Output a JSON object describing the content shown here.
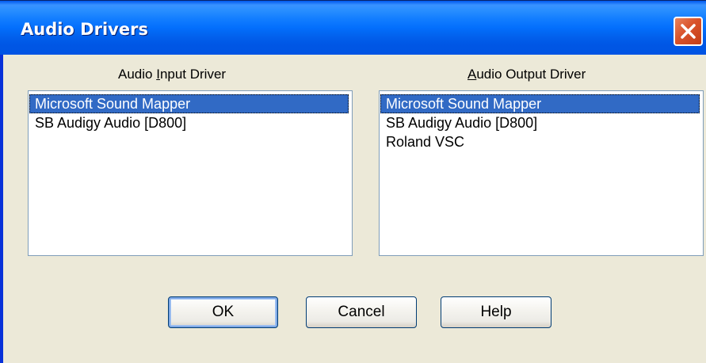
{
  "window": {
    "title": "Audio Drivers"
  },
  "input": {
    "label_before": "Audio ",
    "label_mnemonic": "I",
    "label_after": "nput Driver",
    "items": [
      "Microsoft Sound Mapper",
      "SB Audigy Audio [D800]"
    ],
    "selected_index": 0
  },
  "output": {
    "label_before": "",
    "label_mnemonic": "A",
    "label_after": "udio Output Driver",
    "items": [
      "Microsoft Sound Mapper",
      "SB Audigy Audio [D800]",
      "Roland VSC"
    ],
    "selected_index": 0
  },
  "buttons": {
    "ok": "OK",
    "cancel": "Cancel",
    "help": "Help"
  },
  "icons": {
    "close": "close-icon"
  },
  "colors": {
    "titlebar": "#0054E3",
    "selection": "#316AC5",
    "close": "#D9532B",
    "face": "#ECE9D8"
  }
}
